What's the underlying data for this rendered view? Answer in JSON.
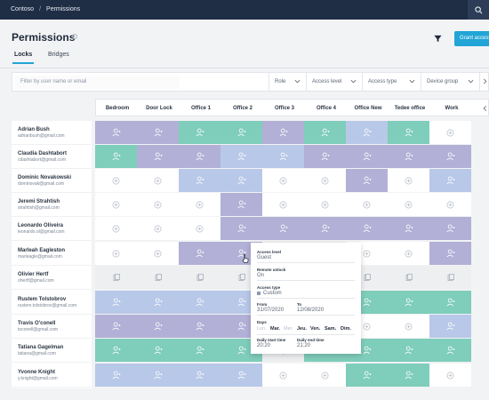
{
  "topbar": {
    "breadcrumb": [
      "Contoso",
      "Permissions"
    ],
    "separator": "/"
  },
  "page": {
    "title": "Permissions",
    "grant_label": "Grant access"
  },
  "tabs": [
    {
      "label": "Locks",
      "active": true
    },
    {
      "label": "Bridges",
      "active": false
    }
  ],
  "filter": {
    "placeholder": "Filter by user name or email",
    "dropdowns": [
      {
        "label": "Role"
      },
      {
        "label": "Access level"
      },
      {
        "label": "Access type"
      },
      {
        "label": "Device group"
      }
    ]
  },
  "columns": [
    "Bedroom",
    "Door Lock",
    "Office 1",
    "Office 2",
    "Office 3",
    "Office 4",
    "Office New",
    "Tedee office",
    "Work"
  ],
  "users": [
    {
      "name": "Adrian Bush",
      "email": "adrianbush@gmail.com"
    },
    {
      "name": "Claudia Dashtabort",
      "email": "cdashtabort@gmail.com"
    },
    {
      "name": "Dominic Novakowski",
      "email": "dominovak@gmail.com"
    },
    {
      "name": "Jeremi Strahtish",
      "email": "strahtish@gmail.com"
    },
    {
      "name": "Leonardo Oliveira",
      "email": "leonardo.ol@gmail.com"
    },
    {
      "name": "Marleah Eagleston",
      "email": "marleagle@gmail.com"
    },
    {
      "name": "Olivier Hertf",
      "email": "ohertf@gmail.com"
    },
    {
      "name": "Rustem Tolstobrov",
      "email": "rustem.tolstobrov@gmail.com"
    },
    {
      "name": "Travis O'conell",
      "email": "toconell@gmail.com"
    },
    {
      "name": "Tatiana Gagelman",
      "email": "tatiana@gmail.com"
    },
    {
      "name": "Yvonne Knight",
      "email": "y.knight@gmail.com"
    }
  ],
  "colors": {
    "purple": "#b2b0d6",
    "teal": "#7fcdbb",
    "blue": "#b8c8e8",
    "white": "#ffffff",
    "grey": "#eeeff1",
    "accent": "#21a5d6"
  },
  "grid": [
    [
      "purple",
      "purple",
      "teal",
      "teal",
      "purple",
      "teal",
      "blue",
      "teal",
      "white"
    ],
    [
      "teal",
      "purple",
      "purple",
      "blue",
      "blue",
      "purple",
      "purple",
      "purple",
      "purple"
    ],
    [
      "white",
      "white",
      "blue",
      "blue",
      "white",
      "white",
      "purple",
      "white",
      "blue"
    ],
    [
      "white",
      "white",
      "white",
      "purple",
      "white",
      "white",
      "white",
      "white",
      "white"
    ],
    [
      "white",
      "white",
      "white",
      "purple",
      "purple",
      "purple",
      "purple",
      "purple",
      "purple"
    ],
    [
      "white",
      "white",
      "purple",
      "purple",
      "grey",
      "grey",
      "white",
      "white",
      "purple"
    ],
    [
      "grey",
      "grey",
      "grey",
      "grey",
      "grey",
      "grey",
      "grey",
      "grey",
      "grey"
    ],
    [
      "blue",
      "blue",
      "blue",
      "blue",
      "grey",
      "teal",
      "teal",
      "teal",
      "teal"
    ],
    [
      "purple",
      "purple",
      "purple",
      "purple",
      "grey",
      "white",
      "white",
      "white",
      "blue"
    ],
    [
      "teal",
      "teal",
      "teal",
      "teal",
      "grey",
      "teal",
      "teal",
      "teal",
      "teal"
    ],
    [
      "blue",
      "blue",
      "blue",
      "blue",
      "white",
      "white",
      "teal",
      "teal",
      "white"
    ]
  ],
  "icons": {
    "person": "person-icon",
    "add": "add-icon",
    "bridge": "bridge-icon",
    "search": "search-icon",
    "filter": "filter-icon"
  },
  "popup": {
    "access_level_label": "Access level",
    "access_level": "Guest",
    "remote_label": "Remote unlock",
    "remote": "On",
    "type_label": "Access type",
    "type": "Custom",
    "from_label": "From",
    "from": "31/07/2020",
    "to_label": "To",
    "to": "12/08/2020",
    "days_label": "Days",
    "days": [
      {
        "label": "Lun.",
        "on": false
      },
      {
        "label": "Mar.",
        "on": true
      },
      {
        "label": "Mer.",
        "on": false
      },
      {
        "label": "Jeu.",
        "on": true
      },
      {
        "label": "Ven.",
        "on": true
      },
      {
        "label": "Sam.",
        "on": true
      },
      {
        "label": "Dim.",
        "on": true
      }
    ],
    "start_label": "Daily start time",
    "start": "20:20",
    "end_label": "Daily end time",
    "end": "21:20"
  }
}
